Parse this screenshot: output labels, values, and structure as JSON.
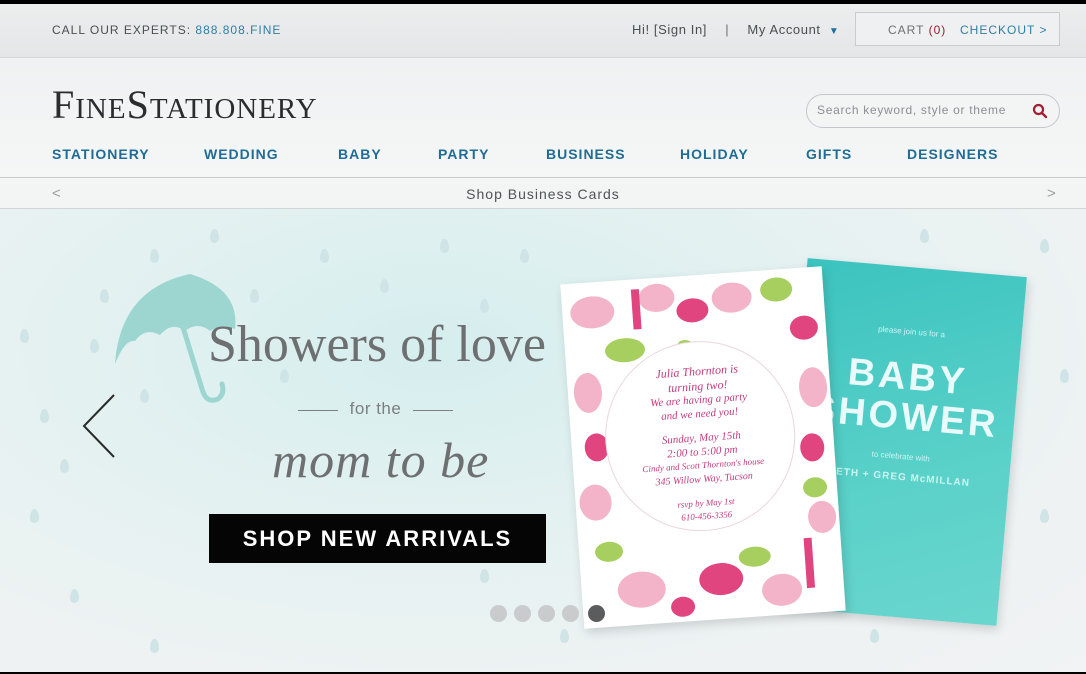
{
  "topbar": {
    "experts_label": "CALL OUR EXPERTS:",
    "phone": "888.808.FINE",
    "greeting": "Hi! [Sign In]",
    "separator": "|",
    "my_account": "My Account",
    "cart_label": "CART",
    "cart_count": "(0)",
    "checkout": "CHECKOUT >"
  },
  "header": {
    "logo_f": "F",
    "logo_ine": "INE",
    "logo_s": "S",
    "logo_tationery": "TATIONERY",
    "search_placeholder": "Search keyword, style or theme"
  },
  "nav": {
    "items": [
      {
        "label": "STATIONERY"
      },
      {
        "label": "WEDDING"
      },
      {
        "label": "BABY"
      },
      {
        "label": "PARTY"
      },
      {
        "label": "BUSINESS"
      },
      {
        "label": "HOLIDAY"
      },
      {
        "label": "GIFTS"
      },
      {
        "label": "DESIGNERS"
      }
    ]
  },
  "promo_strip": {
    "text": "Shop Business Cards",
    "prev": "<",
    "next": ">"
  },
  "hero": {
    "headline": "Showers of love",
    "subline": "for the",
    "tagline": "mom to be",
    "cta": "SHOP NEW ARRIVALS",
    "slide_count": 5,
    "active_slide": 5,
    "pink_card": {
      "lines": [
        "Julia Thornton is",
        "turning two!",
        "We are having a party",
        "and we need you!",
        "Sunday, May 15th",
        "2:00 to 5:00 pm",
        "Cindy and Scott Thornton's house",
        "345 Willow Way, Tucson",
        "rsvp by May 1st",
        "610-456-3356"
      ]
    },
    "teal_card": {
      "top": "please join us for a",
      "title_1": "BABY",
      "title_2": "SHOWER",
      "honoring": "to celebrate with",
      "names": "BETH + GREG McMILLAN"
    }
  },
  "colors": {
    "nav_blue": "#1f6c96",
    "link_blue": "#2f7fa3",
    "cart_red": "#9b1c2e",
    "cta_black": "#050505"
  }
}
